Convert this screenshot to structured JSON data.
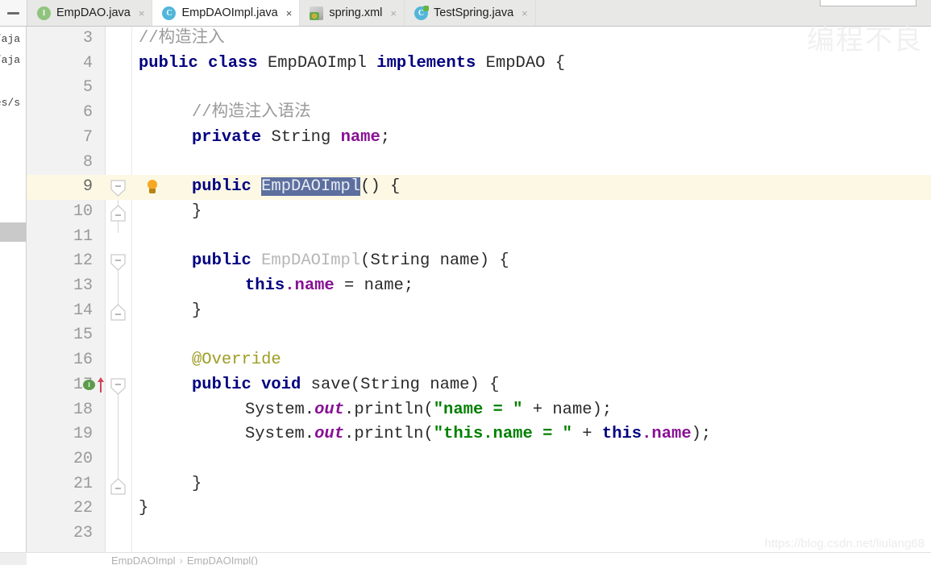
{
  "window": {
    "collapse_icon": "minimize-icon"
  },
  "tabs": [
    {
      "label": "EmpDAO.java",
      "icon": "interface-icon",
      "close": "×",
      "active": false
    },
    {
      "label": "EmpDAOImpl.java",
      "icon": "class-icon",
      "close": "×",
      "active": true
    },
    {
      "label": "spring.xml",
      "icon": "spring-xml-icon",
      "close": "×",
      "active": false
    },
    {
      "label": "TestSpring.java",
      "icon": "class-icon",
      "close": "×",
      "active": false
    }
  ],
  "left_panel_sliver": {
    "fragments": [
      "s/aja",
      "s/aja",
      "des/s"
    ]
  },
  "editor": {
    "first_line_number": 3,
    "current_line": 9,
    "selection_text": "EmpDAOImpl",
    "lines": [
      {
        "n": 3,
        "text": "    //构造注入"
      },
      {
        "n": 4,
        "text": "public class EmpDAOImpl implements EmpDAO {"
      },
      {
        "n": 5,
        "text": ""
      },
      {
        "n": 6,
        "text": "    //构造注入语法"
      },
      {
        "n": 7,
        "text": "    private String name;"
      },
      {
        "n": 8,
        "text": ""
      },
      {
        "n": 9,
        "text": "    public EmpDAOImpl() {"
      },
      {
        "n": 10,
        "text": "    }"
      },
      {
        "n": 11,
        "text": ""
      },
      {
        "n": 12,
        "text": "    public EmpDAOImpl(String name) {"
      },
      {
        "n": 13,
        "text": "        this.name = name;"
      },
      {
        "n": 14,
        "text": "    }"
      },
      {
        "n": 15,
        "text": ""
      },
      {
        "n": 16,
        "text": "    @Override"
      },
      {
        "n": 17,
        "text": "    public void save(String name) {"
      },
      {
        "n": 18,
        "text": "        System.out.println(\"name = \" + name);"
      },
      {
        "n": 19,
        "text": "        System.out.println(\"this.name = \" + this.name);"
      },
      {
        "n": 20,
        "text": ""
      },
      {
        "n": 21,
        "text": "    }"
      },
      {
        "n": 22,
        "text": "}"
      },
      {
        "n": 23,
        "text": ""
      }
    ],
    "tokens": {
      "l3_comment": "//构造注入",
      "l4_public": "public",
      "l4_class": "class",
      "l4_name": "EmpDAOImpl",
      "l4_implements": "implements",
      "l4_iface": "EmpDAO",
      "l4_brace": "{",
      "l6_comment": "//构造注入语法",
      "l7_private": "private",
      "l7_type": "String",
      "l7_field": "name",
      "l7_semi": ";",
      "l9_public": "public",
      "l9_ctor": "EmpDAOImpl",
      "l9_rest": "() {",
      "l10_brace": "}",
      "l12_public": "public",
      "l12_ctor": "EmpDAOImpl",
      "l12_rest": "(String name) {",
      "l13_this": "this",
      "l13_dot_name": ".name",
      "l13_rest": " = name;",
      "l14_brace": "}",
      "l16_override": "@Override",
      "l17_public": "public",
      "l17_void": "void",
      "l17_rest": " save(String name) {",
      "l18_sys": "System.",
      "l18_out": "out",
      "l18_println": ".println(",
      "l18_str": "\"name = \"",
      "l18_tail": " + name);",
      "l19_sys": "System.",
      "l19_out": "out",
      "l19_println": ".println(",
      "l19_str": "\"this.name = \"",
      "l19_plus": " + ",
      "l19_this": "this",
      "l19_field": ".name",
      "l19_tail": ");",
      "l21_brace": "}",
      "l22_brace": "}"
    },
    "gutter": {
      "bulb_icon": "lightbulb-icon",
      "bulb_line": 9,
      "implements_icon": "implementing-method-icon",
      "implements_line": 17,
      "fold_lines": [
        9,
        10,
        12,
        14,
        17,
        21
      ]
    }
  },
  "breadcrumb": {
    "class": "EmpDAOImpl",
    "separator": "›",
    "member": "EmpDAOImpl()"
  },
  "watermarks": {
    "chinese": "编程不良",
    "url": "https://blog.csdn.net/liulang68"
  },
  "colors": {
    "keyword": "#000080",
    "string": "#008000",
    "field": "#871094",
    "comment": "#9a9a9a",
    "annotation": "#9e9d24",
    "selection": "#5c6f9e",
    "current_line": "#fcf8e4",
    "gutter": "#f2f2f2"
  }
}
